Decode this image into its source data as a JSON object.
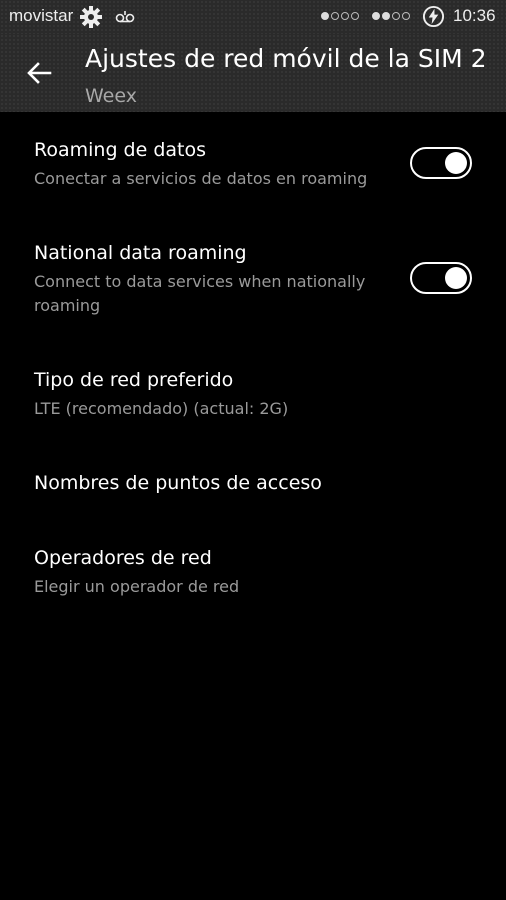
{
  "status_bar": {
    "carrier": "movistar",
    "time": "10:36",
    "icons": [
      "gear-icon",
      "voicemail-icon",
      "signal-sim1-icon",
      "signal-sim2-icon",
      "battery-charging-icon"
    ],
    "signal_sim1_bars": 1,
    "signal_sim2_bars": 2,
    "signal_max_bars": 4
  },
  "header": {
    "title": "Ajustes de red móvil de la SIM 2",
    "subtitle": "Weex",
    "back_icon": "arrow-left-icon"
  },
  "settings": [
    {
      "title": "Roaming de datos",
      "summary": "Conectar a servicios de datos en roaming",
      "toggle": true,
      "enabled": true
    },
    {
      "title": "National data roaming",
      "summary": "Connect to data services when nationally roaming",
      "toggle": true,
      "enabled": true
    },
    {
      "title": "Tipo de red preferido",
      "summary": "LTE (recomendado) (actual: 2G)",
      "toggle": false
    },
    {
      "title": "Nombres de puntos de acceso",
      "summary": "",
      "toggle": false
    },
    {
      "title": "Operadores de red",
      "summary": "Elegir un operador de red",
      "toggle": false
    }
  ],
  "colors": {
    "background": "#000000",
    "header_background": "#2a2a2a",
    "primary_text": "#ffffff",
    "secondary_text": "#9a9a9a"
  }
}
